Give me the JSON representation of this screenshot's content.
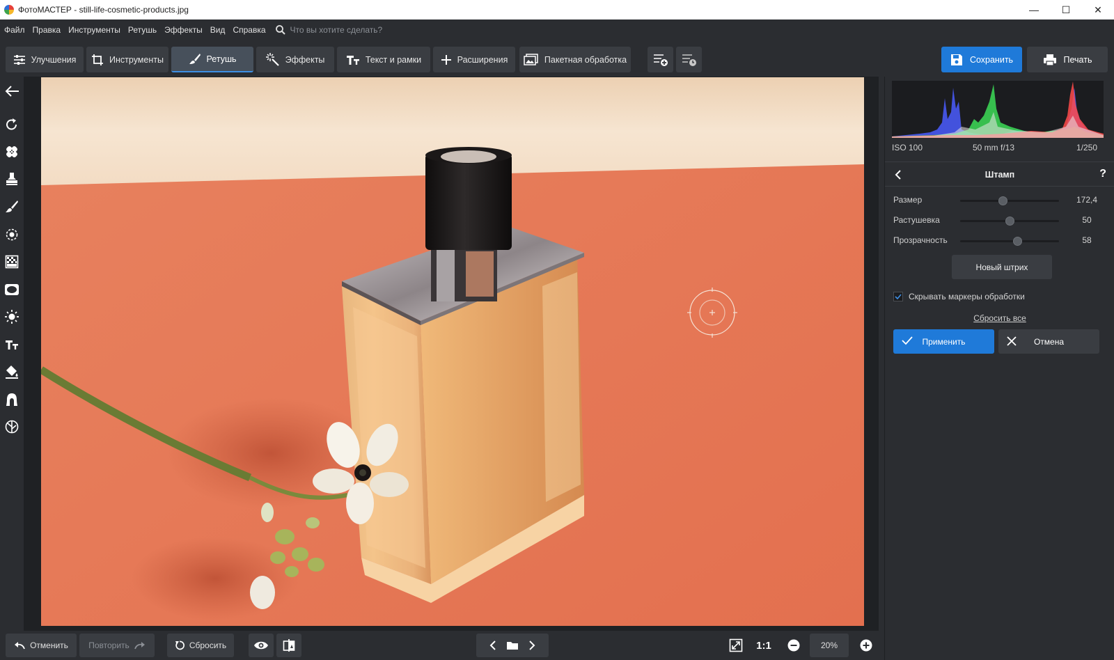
{
  "window": {
    "title": "ФотоМАСТЕР - still-life-cosmetic-products.jpg",
    "controls": [
      "—",
      "☐",
      "✕"
    ]
  },
  "menu": {
    "items": [
      "Файл",
      "Правка",
      "Инструменты",
      "Ретушь",
      "Эффекты",
      "Вид",
      "Справка"
    ],
    "search_placeholder": "Что вы хотите сделать?"
  },
  "toolbar": {
    "tabs": [
      {
        "label": "Улучшения",
        "icon": "sliders-icon",
        "active": false
      },
      {
        "label": "Инструменты",
        "icon": "crop-icon",
        "active": false
      },
      {
        "label": "Ретушь",
        "icon": "brush-icon",
        "active": true
      },
      {
        "label": "Эффекты",
        "icon": "magic-wand-icon",
        "active": false
      },
      {
        "label": "Текст и рамки",
        "icon": "text-icon",
        "active": false
      },
      {
        "label": "Расширения",
        "icon": "plus-icon",
        "active": false
      },
      {
        "label": "Пакетная обработка",
        "icon": "batch-icon",
        "active": false
      }
    ],
    "save_label": "Сохранить",
    "print_label": "Печать"
  },
  "left_tools": [
    "back-arrow-icon",
    "rotate-icon",
    "healing-patch-icon",
    "stamp-icon",
    "brush-icon",
    "radial-filter-icon",
    "gradient-filter-icon",
    "vignette-icon",
    "light-icon",
    "text-icon",
    "fill-bucket-icon",
    "portrait-icon",
    "globe-icon"
  ],
  "bottom": {
    "undo_label": "Отменить",
    "redo_label": "Повторить",
    "reset_label": "Сбросить",
    "ratio_label": "1:1",
    "zoom_value": "20%"
  },
  "panel": {
    "exif": {
      "iso": "ISO 100",
      "lens": "50 mm f/13",
      "shutter": "1/250"
    },
    "tool_title": "Штамп",
    "help": "?",
    "sliders": [
      {
        "label": "Размер",
        "value": "172,4",
        "fraction": 0.43
      },
      {
        "label": "Растушевка",
        "value": "50",
        "fraction": 0.5
      },
      {
        "label": "Прозрачность",
        "value": "58",
        "fraction": 0.58
      }
    ],
    "new_stroke_label": "Новый штрих",
    "hide_markers_label": "Скрывать маркеры обработки",
    "hide_markers_checked": true,
    "reset_all_label": "Сбросить все",
    "apply_label": "Применить",
    "cancel_label": "Отмена"
  },
  "colors": {
    "accent": "#1f7ad9",
    "background": "#2b2d31",
    "button": "#3a3d42",
    "photo_wall": "#f3dcc4",
    "photo_table": "#e57b5a"
  }
}
